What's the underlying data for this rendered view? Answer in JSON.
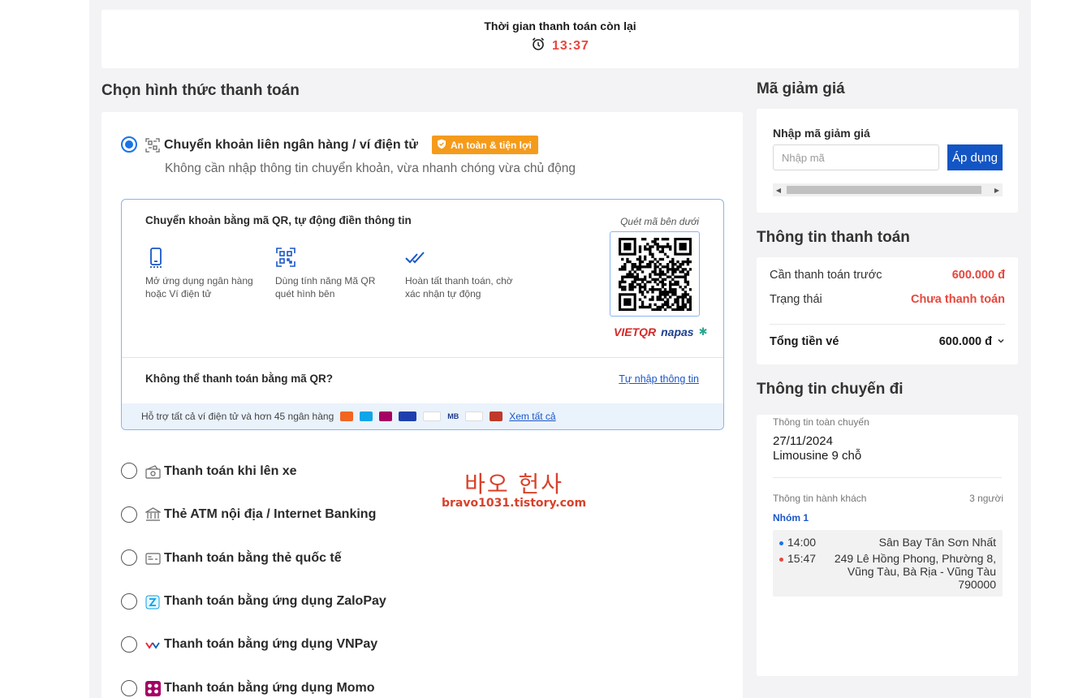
{
  "timer": {
    "title": "Thời gian thanh toán còn lại",
    "remaining": "13:37"
  },
  "payment": {
    "section_title": "Chọn hình thức thanh toán",
    "options": [
      {
        "label": "Chuyển khoản liên ngân hàng / ví điện tử",
        "icon": "qr-scan-icon",
        "selected": true
      },
      {
        "label": "Thanh toán khi lên xe",
        "icon": "cash-icon",
        "selected": false
      },
      {
        "label": "Thẻ ATM nội địa / Internet Banking",
        "icon": "bank-icon",
        "selected": false
      },
      {
        "label": "Thanh toán bằng thẻ quốc tế",
        "icon": "credit-card-icon",
        "selected": false
      },
      {
        "label": "Thanh toán bằng ứng dụng ZaloPay",
        "icon": "zalopay-icon",
        "selected": false
      },
      {
        "label": "Thanh toán bằng ứng dụng VNPay",
        "icon": "vnpay-icon",
        "selected": false
      },
      {
        "label": "Thanh toán bằng ứng dụng Momo",
        "icon": "momo-icon",
        "selected": false
      }
    ],
    "badge": "An toàn & tiện lợi",
    "subtitle": "Không cần nhập thông tin chuyển khoản, vừa nhanh chóng vừa chủ động",
    "qr": {
      "heading": "Chuyển khoản bằng mã QR, tự động điền thông tin",
      "steps": [
        {
          "icon": "phone-icon",
          "text": "Mở ứng dụng ngân hàng hoặc Ví điện tử"
        },
        {
          "icon": "qr-icon",
          "text": "Dùng tính năng Mã QR quét hình bên"
        },
        {
          "icon": "double-check-icon",
          "text": "Hoàn tất thanh toán, chờ xác nhận tự động"
        }
      ],
      "scan_label": "Quét mã bên dưới",
      "brand_vietqr": "VIETQR",
      "brand_napas": "napas",
      "cant_scan": "Không thể thanh toán bằng mã QR?",
      "manual_link": "Tự nhập thông tin",
      "support_text": "Hỗ trợ tất cả ví điện tử và hơn 45 ngân hàng",
      "support_logo_mb": "MB",
      "support_link": "Xem tất cả"
    }
  },
  "watermark": {
    "title": "바오 헌사",
    "url": "bravo1031.tistory.com"
  },
  "coupon": {
    "section_title": "Mã giảm giá",
    "label": "Nhập mã giảm giá",
    "placeholder": "Nhập mã",
    "value": "",
    "apply_label": "Áp dụng"
  },
  "payment_info": {
    "section_title": "Thông tin thanh toán",
    "rows": [
      {
        "label": "Cần thanh toán trước",
        "value": "600.000 đ"
      },
      {
        "label": "Trạng thái",
        "value": "Chưa thanh toán"
      }
    ],
    "total_label": "Tổng tiền vé",
    "total_value": "600.000 đ"
  },
  "trip_info": {
    "section_title": "Thông tin chuyến đi",
    "overview_label": "Thông tin toàn chuyến",
    "date": "27/11/2024",
    "vehicle": "Limousine 9 chỗ",
    "passenger_label": "Thông tin hành khách",
    "passenger_count": "3 người",
    "group_label": "Nhóm 1",
    "stops": [
      {
        "time": "14:00",
        "place": "Sân Bay Tân Sơn Nhất",
        "color": "#1a73e8"
      },
      {
        "time": "15:47",
        "place": "249 Lê Hồng Phong, Phường 8, Vũng Tàu, Bà Rịa - Vũng Tàu 790000",
        "color": "#e8473d"
      }
    ]
  },
  "colors": {
    "accent": "#1a73e8",
    "danger": "#e8473d",
    "badge": "#f59b1b",
    "button": "#1355c4"
  }
}
